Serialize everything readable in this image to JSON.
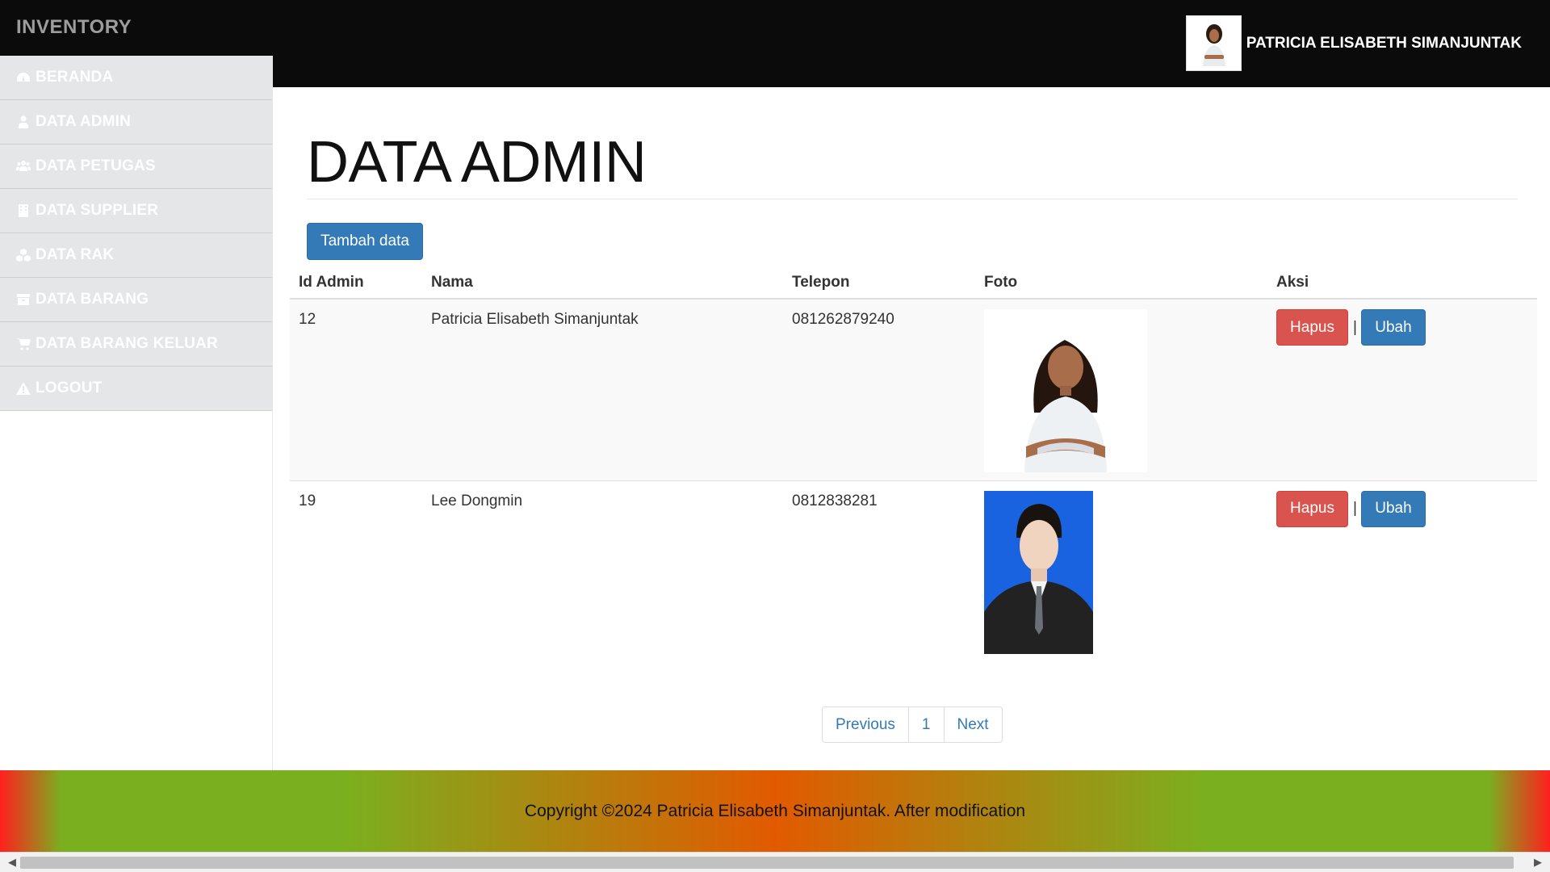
{
  "brand": "INVENTORY",
  "user": {
    "name": "PATRICIA ELISABETH SIMANJUNTAK"
  },
  "sidebar": {
    "items": [
      {
        "label": "BERANDA",
        "icon": "dashboard-icon"
      },
      {
        "label": "DATA ADMIN",
        "icon": "user-icon"
      },
      {
        "label": "DATA PETUGAS",
        "icon": "users-icon"
      },
      {
        "label": "DATA SUPPLIER",
        "icon": "building-icon"
      },
      {
        "label": "DATA RAK",
        "icon": "cubes-icon"
      },
      {
        "label": "DATA BARANG",
        "icon": "archive-icon"
      },
      {
        "label": "DATA BARANG KELUAR",
        "icon": "cart-icon"
      },
      {
        "label": "LOGOUT",
        "icon": "warning-icon"
      }
    ]
  },
  "main": {
    "title": "DATA ADMIN",
    "add_button": "Tambah data",
    "table": {
      "headers": [
        "Id Admin",
        "Nama",
        "Telepon",
        "Foto",
        "Aksi"
      ],
      "rows": [
        {
          "id": "12",
          "nama": "Patricia Elisabeth Simanjuntak",
          "telepon": "081262879240",
          "hapus": "Hapus",
          "sep": "|",
          "ubah": "Ubah"
        },
        {
          "id": "19",
          "nama": "Lee Dongmin",
          "telepon": "0812838281",
          "hapus": "Hapus",
          "sep": "|",
          "ubah": "Ubah"
        }
      ]
    },
    "pagination": {
      "previous": "Previous",
      "page": "1",
      "next": "Next"
    }
  },
  "footer": {
    "text": "Copyright ©2024 Patricia Elisabeth Simanjuntak. After modification"
  },
  "colors": {
    "primary": "#337ab7",
    "danger": "#d9534f",
    "topbar": "#0c0b0b",
    "sidebar": "#e5e6e8"
  }
}
